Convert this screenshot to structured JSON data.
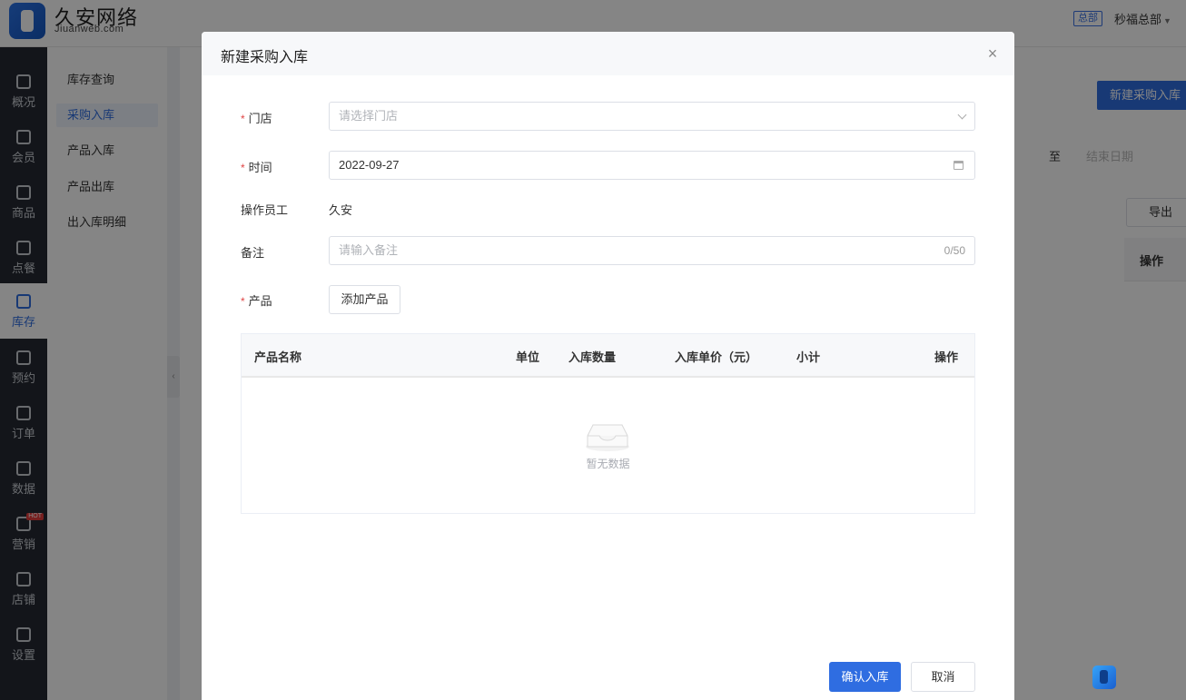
{
  "app": {
    "brand_name": "久安网络",
    "brand_sub": "Jiuanweb.com",
    "hq_badge": "总部",
    "user": "秒福总部"
  },
  "nav": {
    "items": [
      {
        "label": "概况",
        "icon": "grid-icon"
      },
      {
        "label": "会员",
        "icon": "crown-icon"
      },
      {
        "label": "商品",
        "icon": "box-icon"
      },
      {
        "label": "点餐",
        "icon": "dish-icon"
      },
      {
        "label": "库存",
        "icon": "inventory-icon",
        "active": true
      },
      {
        "label": "预约",
        "icon": "calendar-check-icon"
      },
      {
        "label": "订单",
        "icon": "clipboard-icon"
      },
      {
        "label": "数据",
        "icon": "chart-icon"
      },
      {
        "label": "营销",
        "icon": "shop-bag-icon",
        "badge": "HOT"
      },
      {
        "label": "店铺",
        "icon": "store-icon"
      },
      {
        "label": "设置",
        "icon": "settings-icon"
      }
    ]
  },
  "subnav": {
    "items": [
      "库存查询",
      "采购入库",
      "产品入库",
      "产品出库",
      "出入库明细"
    ],
    "active_index": 1
  },
  "background": {
    "new_button": "新建采购入库",
    "to": "至",
    "end_date": "结束日期",
    "export": "导出",
    "op_header": "操作"
  },
  "modal": {
    "title": "新建采购入库",
    "close_glyph": "×",
    "required_mark": "*",
    "fields": {
      "store": {
        "label": "门店",
        "placeholder": "请选择门店"
      },
      "time": {
        "label": "时间",
        "value": "2022-09-27"
      },
      "operator": {
        "label": "操作员工",
        "value": "久安"
      },
      "remark": {
        "label": "备注",
        "placeholder": "请输入备注",
        "counter": "0/50"
      },
      "product": {
        "label": "产品",
        "add_button": "添加产品"
      }
    },
    "table": {
      "columns": [
        "产品名称",
        "单位",
        "入库数量",
        "入库单价（元）",
        "小计",
        "操作"
      ],
      "empty_text": "暂无数据"
    },
    "confirm_button": "确认入库",
    "cancel_button": "取消"
  },
  "colors": {
    "primary": "#2f6de1",
    "required": "#e04545",
    "nav_bg": "#252a33"
  }
}
